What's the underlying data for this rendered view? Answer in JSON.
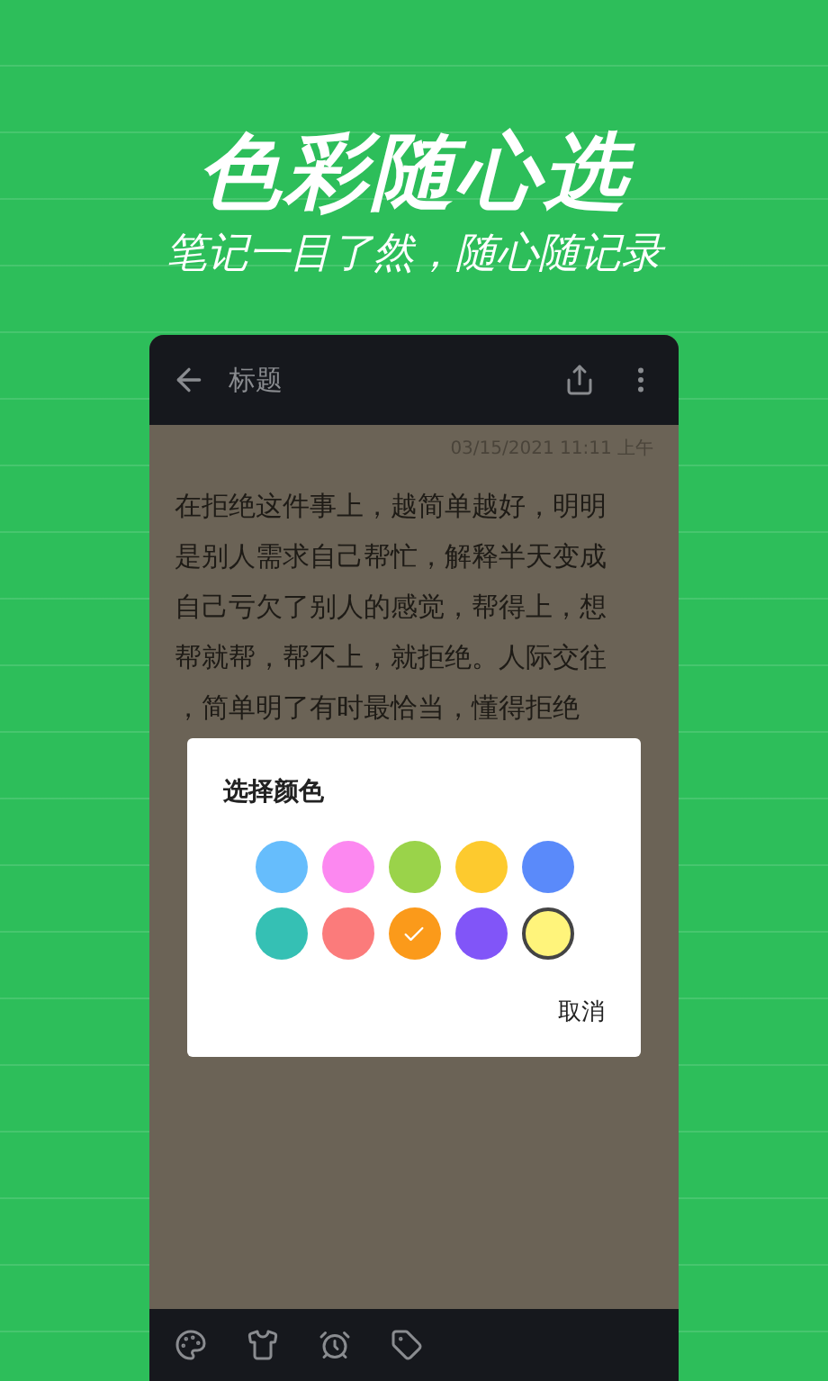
{
  "banner": {
    "title": "色彩随心选",
    "subtitle": "笔记一目了然，随心随记录"
  },
  "note": {
    "title": "标题",
    "date": "03/15/2021 11:11 上午",
    "lines": [
      "在拒绝这件事上，越简单越好，明明",
      "是别人需求自己帮忙，解释半天变成",
      "自己亏欠了别人的感觉，帮得上，想",
      "帮就帮，帮不上，就拒绝。人际交往",
      "，简单明了有时最恰当，懂得拒绝"
    ]
  },
  "dialog": {
    "title": "选择颜色",
    "cancel": "取消",
    "colors": [
      {
        "color": "#66bdfc",
        "selected": false
      },
      {
        "color": "#fc88f0",
        "selected": false
      },
      {
        "color": "#9ad34a",
        "selected": false
      },
      {
        "color": "#fdca2e",
        "selected": false
      },
      {
        "color": "#5a8afa",
        "selected": false
      },
      {
        "color": "#35c0b4",
        "selected": false
      },
      {
        "color": "#fb7b7b",
        "selected": false
      },
      {
        "color": "#fb9a1a",
        "selected": true
      },
      {
        "color": "#8155f8",
        "selected": false
      },
      {
        "color": "#fff47b",
        "selected": false
      }
    ]
  }
}
